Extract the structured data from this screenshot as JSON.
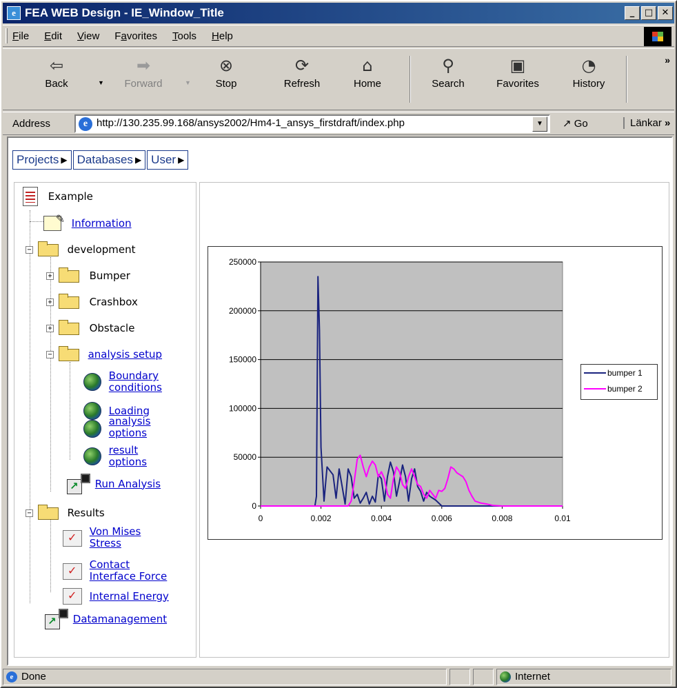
{
  "window": {
    "title": "FEA WEB Design - IE_Window_Title"
  },
  "menu": [
    {
      "label": "File",
      "key": "F",
      "rest": "ile"
    },
    {
      "label": "Edit",
      "key": "E",
      "rest": "dit"
    },
    {
      "label": "View",
      "key": "V",
      "rest": "iew"
    },
    {
      "label": "Favorites",
      "key": "a",
      "pre": "F",
      "rest": "vorites"
    },
    {
      "label": "Tools",
      "key": "T",
      "rest": "ools"
    },
    {
      "label": "Help",
      "key": "H",
      "rest": "elp"
    }
  ],
  "toolbar": {
    "back": "Back",
    "forward": "Forward",
    "stop": "Stop",
    "refresh": "Refresh",
    "home": "Home",
    "search": "Search",
    "favorites": "Favorites",
    "history": "History"
  },
  "address": {
    "label": "Address",
    "url": "http://130.235.99.168/ansys2002/Hm4-1_ansys_firstdraft/index.php",
    "go": "Go",
    "links": "Länkar"
  },
  "topnav": [
    "Projects",
    "Databases",
    "User"
  ],
  "tree": {
    "root": "Example",
    "information": "Information",
    "development": "development",
    "bumper": "Bumper",
    "crashbox": "Crashbox",
    "obstacle": "Obstacle",
    "analysis_setup": "analysis setup",
    "boundary_1": "Boundary",
    "boundary_2": "conditions",
    "loading": "Loading",
    "analysis_options_1": "analysis",
    "analysis_options_2": "options",
    "result_options_1": "result",
    "result_options_2": "options",
    "run_analysis": "Run Analysis",
    "results": "Results",
    "von_mises_1": "Von Mises",
    "von_mises_2": "Stress",
    "contact_1": "Contact",
    "contact_2": "Interface Force",
    "internal_energy": "Internal Energy",
    "datamanagement": "Datamanagement"
  },
  "chart_data": {
    "type": "line",
    "title": "",
    "xlabel": "",
    "ylabel": "",
    "xlim": [
      0,
      0.01
    ],
    "ylim": [
      0,
      250000
    ],
    "x_ticks": [
      "0",
      "0.002",
      "0.004",
      "0.006",
      "0.008",
      "0.01"
    ],
    "y_ticks": [
      "0",
      "50000",
      "100000",
      "150000",
      "200000",
      "250000"
    ],
    "grid": "horizontal",
    "legend_position": "right",
    "plot_background": "#c0c0c0",
    "series": [
      {
        "name": "bumper 1",
        "color": "#1a237e",
        "points": [
          [
            0,
            0
          ],
          [
            0.0018,
            0
          ],
          [
            0.00185,
            10000
          ],
          [
            0.0019,
            235000
          ],
          [
            0.00195,
            180000
          ],
          [
            0.002,
            60000
          ],
          [
            0.0021,
            5000
          ],
          [
            0.0022,
            40000
          ],
          [
            0.0024,
            32000
          ],
          [
            0.0025,
            8000
          ],
          [
            0.0026,
            38000
          ],
          [
            0.0027,
            20000
          ],
          [
            0.0028,
            2000
          ],
          [
            0.0029,
            38000
          ],
          [
            0.003,
            30000
          ],
          [
            0.0031,
            8000
          ],
          [
            0.0032,
            12000
          ],
          [
            0.0033,
            3000
          ],
          [
            0.0034,
            8000
          ],
          [
            0.0035,
            14000
          ],
          [
            0.0036,
            2000
          ],
          [
            0.0037,
            10000
          ],
          [
            0.0038,
            4000
          ],
          [
            0.0039,
            32000
          ],
          [
            0.004,
            28000
          ],
          [
            0.0041,
            5000
          ],
          [
            0.0042,
            30000
          ],
          [
            0.0043,
            45000
          ],
          [
            0.0044,
            35000
          ],
          [
            0.0045,
            10000
          ],
          [
            0.0046,
            25000
          ],
          [
            0.0047,
            42000
          ],
          [
            0.0048,
            30000
          ],
          [
            0.0049,
            5000
          ],
          [
            0.005,
            28000
          ],
          [
            0.0051,
            38000
          ],
          [
            0.0052,
            20000
          ],
          [
            0.0053,
            15000
          ],
          [
            0.0054,
            5000
          ],
          [
            0.0055,
            14000
          ],
          [
            0.0056,
            10000
          ],
          [
            0.0058,
            6000
          ],
          [
            0.006,
            0
          ],
          [
            0.01,
            0
          ]
        ]
      },
      {
        "name": "bumper 2",
        "color": "#ff00ff",
        "points": [
          [
            0,
            0
          ],
          [
            0.0029,
            0
          ],
          [
            0.003,
            5000
          ],
          [
            0.0031,
            25000
          ],
          [
            0.0032,
            48000
          ],
          [
            0.0033,
            52000
          ],
          [
            0.0034,
            40000
          ],
          [
            0.0035,
            30000
          ],
          [
            0.0036,
            40000
          ],
          [
            0.0037,
            46000
          ],
          [
            0.0038,
            42000
          ],
          [
            0.0039,
            30000
          ],
          [
            0.004,
            35000
          ],
          [
            0.0041,
            28000
          ],
          [
            0.0042,
            12000
          ],
          [
            0.0043,
            8000
          ],
          [
            0.0044,
            28000
          ],
          [
            0.0045,
            40000
          ],
          [
            0.0046,
            35000
          ],
          [
            0.0047,
            22000
          ],
          [
            0.0048,
            18000
          ],
          [
            0.0049,
            30000
          ],
          [
            0.005,
            38000
          ],
          [
            0.0051,
            30000
          ],
          [
            0.0052,
            22000
          ],
          [
            0.0053,
            20000
          ],
          [
            0.0054,
            12000
          ],
          [
            0.0055,
            8000
          ],
          [
            0.0056,
            16000
          ],
          [
            0.0057,
            12000
          ],
          [
            0.0058,
            8000
          ],
          [
            0.0059,
            16000
          ],
          [
            0.006,
            15000
          ],
          [
            0.0061,
            18000
          ],
          [
            0.0062,
            28000
          ],
          [
            0.0063,
            40000
          ],
          [
            0.0064,
            38000
          ],
          [
            0.0065,
            34000
          ],
          [
            0.0066,
            32000
          ],
          [
            0.0067,
            30000
          ],
          [
            0.0068,
            25000
          ],
          [
            0.0069,
            16000
          ],
          [
            0.007,
            10000
          ],
          [
            0.0071,
            5000
          ],
          [
            0.0072,
            4000
          ],
          [
            0.0073,
            3000
          ],
          [
            0.0075,
            2000
          ],
          [
            0.0077,
            500
          ],
          [
            0.008,
            0
          ],
          [
            0.01,
            0
          ]
        ]
      }
    ]
  },
  "status": {
    "done": "Done",
    "zone": "Internet"
  }
}
